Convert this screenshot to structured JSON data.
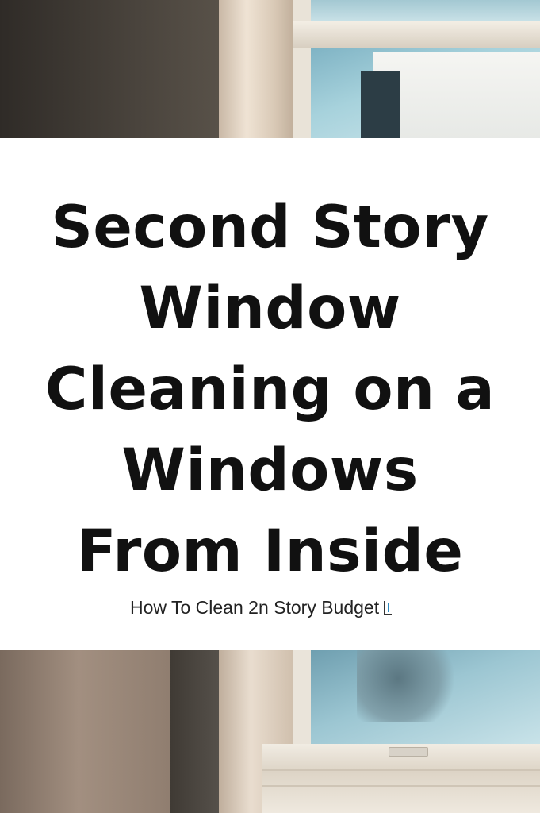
{
  "title": {
    "line1": "Second Story",
    "line2": "Window",
    "line3": "Cleaning on a",
    "line4": "Windows",
    "line5": "From Inside"
  },
  "subtitle": {
    "text": "How To Clean 2n Story Budget",
    "trailing_icon": "bracket-icon"
  },
  "images": {
    "top": "window-photo-top",
    "bottom": "window-photo-bottom"
  },
  "colors": {
    "title_text": "#111111",
    "panel_background": "#ffffff",
    "glass": "#a7d2dc"
  }
}
